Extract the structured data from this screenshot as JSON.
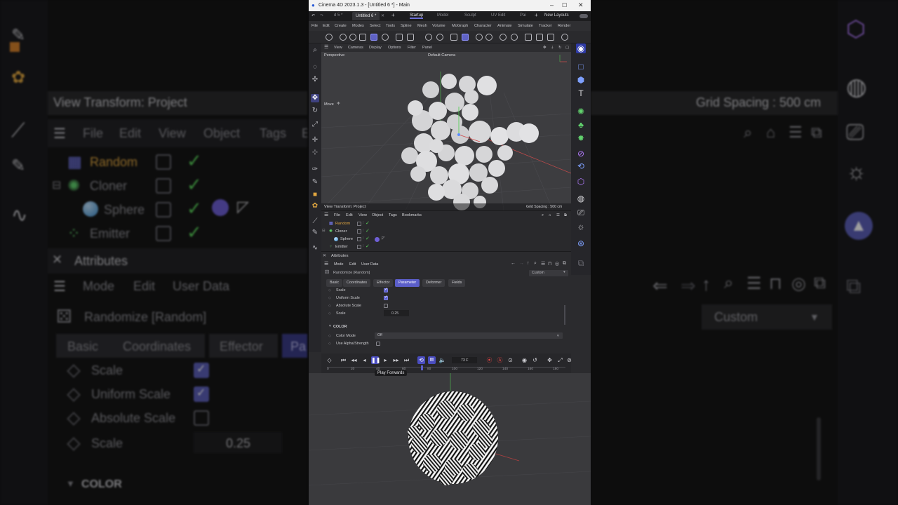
{
  "app": {
    "window_title": "Cinema 4D 2023.1.3 - [Untitled 6 *] - Main",
    "doc_tabs": [
      "d 5 *",
      "Untitled 6 *"
    ],
    "layouts": [
      "Startup",
      "Model",
      "Sculpt",
      "UV Edit",
      "Pai"
    ],
    "new_layouts": "New Layouts"
  },
  "menu": [
    "File",
    "Edit",
    "Create",
    "Modes",
    "Select",
    "Tools",
    "Spline",
    "Mesh",
    "Volume",
    "MoGraph",
    "Character",
    "Animate",
    "Simulate",
    "Tracker",
    "Render"
  ],
  "viewport": {
    "menu": [
      "View",
      "Cameras",
      "Display",
      "Options",
      "Filter",
      "Panel"
    ],
    "name": "Perspective",
    "camera": "Default Camera",
    "tool": "Move",
    "view_transform": "View Transform: Project",
    "grid_spacing": "Grid Spacing : 500 cm"
  },
  "object_manager": {
    "menu": [
      "File",
      "Edit",
      "View",
      "Object",
      "Tags",
      "Bookmarks"
    ],
    "objects": [
      {
        "name": "Random",
        "active": true
      },
      {
        "name": "Cloner",
        "active": false
      },
      {
        "name": "Sphere",
        "active": false
      },
      {
        "name": "Emitter",
        "active": false
      }
    ]
  },
  "attributes": {
    "header": "Attributes",
    "menu": [
      "Mode",
      "Edit",
      "User Data"
    ],
    "object_title": "Randomize [Random]",
    "preset": "Custom",
    "tabs": [
      "Basic",
      "Coordinates",
      "Effector",
      "Parameter",
      "Deformer",
      "Fields"
    ],
    "active_tab": "Parameter",
    "props": {
      "scale": "Scale",
      "uniform_scale": "Uniform Scale",
      "absolute_scale": "Absolute Scale",
      "scale_value_label": "Scale",
      "scale_value": "0.25"
    },
    "color_section": "COLOR",
    "color_mode_label": "Color Mode",
    "color_mode_value": "Off",
    "use_alpha_label": "Use Alpha/Strength"
  },
  "timeline": {
    "current_frame": "73 F",
    "ticks": [
      "0",
      "20",
      "40",
      "60",
      "80",
      "100",
      "120",
      "140",
      "160",
      "180"
    ],
    "tooltip": "Play Forwards"
  },
  "background": {
    "left": {
      "view_transform": "View Transform: Project",
      "menu": [
        "File",
        "Edit",
        "View",
        "Object",
        "Tags",
        "E"
      ],
      "objects": [
        "Random",
        "Cloner",
        "Sphere",
        "Emitter"
      ],
      "attributes": "Attributes",
      "attr_menu": [
        "Mode",
        "Edit",
        "User Data"
      ],
      "object_title": "Randomize [Random]",
      "tabs": [
        "Basic",
        "Coordinates",
        "Effector",
        "Pa"
      ],
      "props": [
        "Scale",
        "Uniform Scale",
        "Absolute Scale",
        "Scale"
      ],
      "scale_value": "0.25",
      "color_section": "COLOR"
    },
    "right": {
      "grid_spacing": "Grid Spacing : 500 cm",
      "preset": "Custom"
    }
  },
  "colors": {
    "accent": "#5b5ec9",
    "active_object": "#e0a640",
    "check_green": "#5bd35b"
  }
}
